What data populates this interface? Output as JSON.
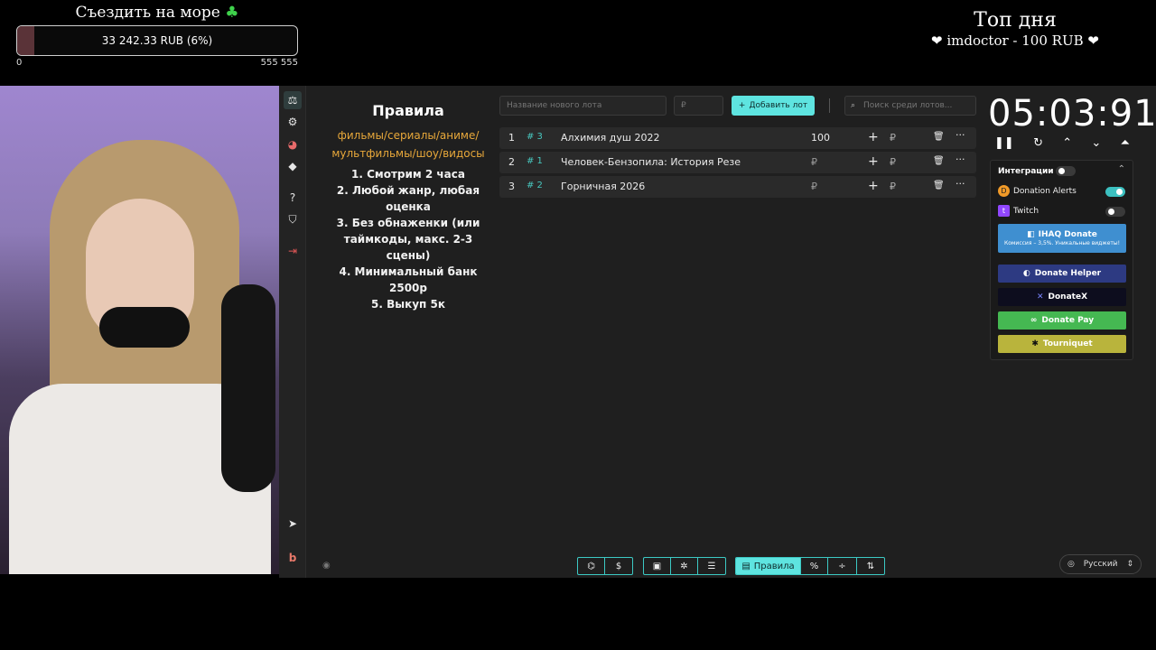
{
  "goal": {
    "title": "Съездить на море",
    "icon": "clover-icon",
    "amount_text": "33 242.33 RUB (6%)",
    "progress_percent": 6,
    "min": "0",
    "max": "555 555"
  },
  "top_day": {
    "title": "Топ дня",
    "entry": "❤ imdoctor - 100 RUB ❤"
  },
  "sidebar": {
    "items": [
      {
        "name": "auction-icon",
        "glyph": "⚖"
      },
      {
        "name": "settings-icon",
        "glyph": "⚙"
      },
      {
        "name": "wheel-icon",
        "glyph": "◕"
      },
      {
        "name": "layers-icon",
        "glyph": "◆"
      },
      {
        "name": "help-icon",
        "glyph": "?"
      },
      {
        "name": "shield-icon",
        "glyph": "⛉"
      },
      {
        "name": "logout-icon",
        "glyph": "⇥"
      },
      {
        "name": "telegram-icon",
        "glyph": "➤"
      },
      {
        "name": "brand-icon",
        "glyph": "b"
      },
      {
        "name": "eye-icon",
        "glyph": "◉"
      }
    ]
  },
  "rules": {
    "title": "Правила",
    "categories": "фильмы/сериалы/аниме/мультфильмы/шоу/видосы",
    "items": [
      "1. Смотрим 2 часа",
      "2. Любой жанр, любая оценка",
      "3. Без обнаженки (или таймкоды, макс. 2-3 сцены)",
      "4. Минимальный банк 2500р",
      "5. Выкуп 5к"
    ]
  },
  "toolbar": {
    "new_lot_placeholder": "Название нового лота",
    "amount_placeholder": "₽",
    "add_button": "Добавить лот",
    "search_placeholder": "Поиск среди лотов..."
  },
  "lots": [
    {
      "index": "1",
      "rank": "# 3",
      "name": "Алхимия душ 2022",
      "amount": "100"
    },
    {
      "index": "2",
      "rank": "# 1",
      "name": "Человек-Бензопила: История Резе",
      "amount": "₽"
    },
    {
      "index": "3",
      "rank": "# 2",
      "name": "Горничная 2026",
      "amount": "₽"
    }
  ],
  "timer": {
    "display": "05:03:91",
    "controls": [
      "pause-icon",
      "restart-icon",
      "chevron-up-icon",
      "chevron-down-icon",
      "double-chevron-up-icon"
    ]
  },
  "integrations": {
    "title": "Интеграции",
    "items": [
      {
        "name": "Donation Alerts",
        "enabled": true
      },
      {
        "name": "Twitch",
        "enabled": false
      }
    ],
    "providers": [
      {
        "name": "IHAQ Donate",
        "subtitle": "Комиссия – 3,5%. Уникальные виджеты!",
        "color": "#3f8fd0"
      },
      {
        "name": "Donate Helper",
        "color": "#2d3a82"
      },
      {
        "name": "DonateX",
        "color": "#0d0d1e"
      },
      {
        "name": "Donate Pay",
        "color": "#45b852"
      },
      {
        "name": "Tourniquet",
        "color": "#b9b43c"
      }
    ]
  },
  "bottom_bar": {
    "active_label": "Правила"
  },
  "language": {
    "selected": "Русский"
  },
  "colors": {
    "accent": "#5ee4e0",
    "rules_categories": "#e8a83a",
    "rank": "#48c7bf"
  }
}
